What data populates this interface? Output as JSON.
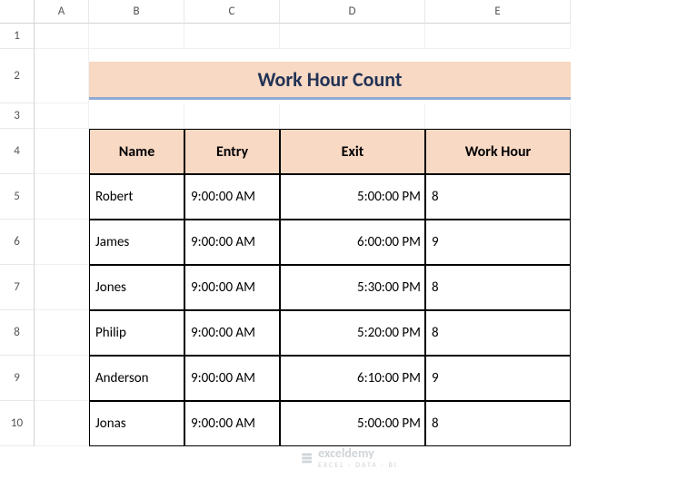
{
  "columns": [
    "A",
    "B",
    "C",
    "D",
    "E"
  ],
  "rows": [
    "1",
    "2",
    "3",
    "4",
    "5",
    "6",
    "7",
    "8",
    "9",
    "10"
  ],
  "title": "Work Hour Count",
  "headers": {
    "name": "Name",
    "entry": "Entry",
    "exit": "Exit",
    "workhour": "Work Hour"
  },
  "chart_data": {
    "type": "table",
    "title": "Work Hour Count",
    "columns": [
      "Name",
      "Entry",
      "Exit",
      "Work Hour"
    ],
    "rows": [
      {
        "name": "Robert",
        "entry": "9:00:00 AM",
        "exit": "5:00:00 PM",
        "workhour": "8"
      },
      {
        "name": "James",
        "entry": "9:00:00 AM",
        "exit": "6:00:00 PM",
        "workhour": "9"
      },
      {
        "name": "Jones",
        "entry": "9:00:00 AM",
        "exit": "5:30:00 PM",
        "workhour": "8"
      },
      {
        "name": "Philip",
        "entry": "9:00:00 AM",
        "exit": "5:20:00 PM",
        "workhour": "8"
      },
      {
        "name": "Anderson",
        "entry": "9:00:00 AM",
        "exit": "6:10:00 PM",
        "workhour": "9"
      },
      {
        "name": "Jonas",
        "entry": "9:00:00 AM",
        "exit": "5:00:00 PM",
        "workhour": "8"
      }
    ]
  },
  "watermark": {
    "brand": "exceldemy",
    "sub": "EXCEL · DATA · BI"
  }
}
